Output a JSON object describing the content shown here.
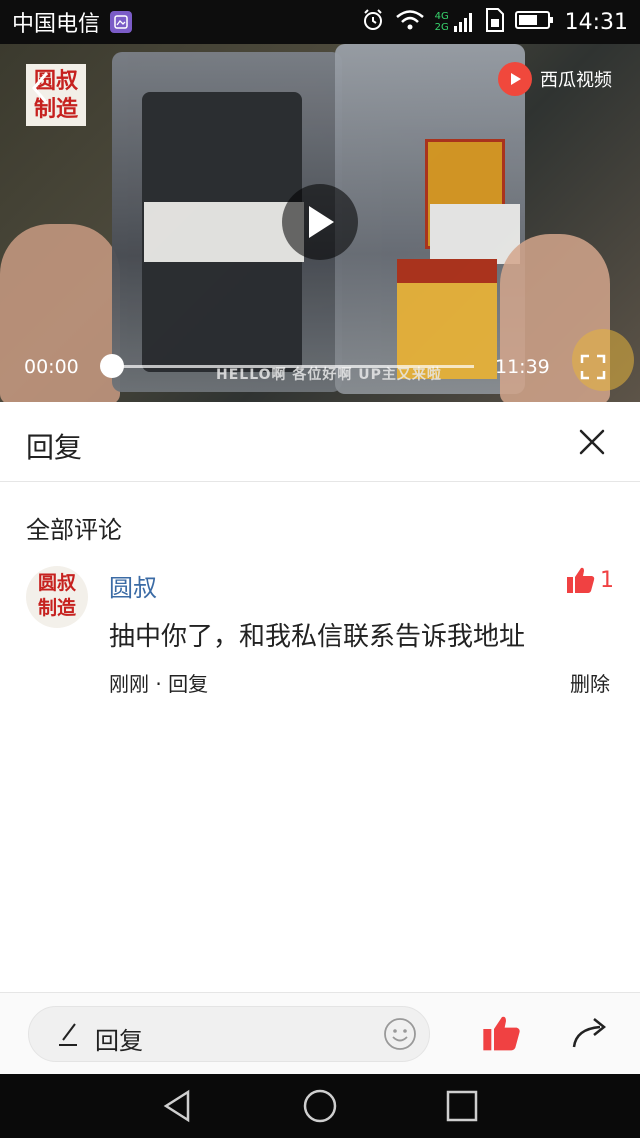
{
  "status_bar": {
    "carrier": "中国电信",
    "network": "4G 2G",
    "time": "14:31",
    "icons": [
      "gallery-icon",
      "alarm-icon",
      "wifi-icon",
      "signal-icon",
      "sim-icon",
      "battery-icon"
    ]
  },
  "video": {
    "logo_line1": "圆叔",
    "logo_line2": "制造",
    "brand": "西瓜视频",
    "current_time": "00:00",
    "total_time": "11:39",
    "progress": 0,
    "subtitle": "HELLO啊 各位好啊 UP主又来啦"
  },
  "reply_panel": {
    "title": "回复"
  },
  "comments_section": {
    "title": "全部评论"
  },
  "comment": {
    "avatar_line1": "圆叔",
    "avatar_line2": "制造",
    "username": "圆叔",
    "like_count": "1",
    "text": "抽中你了，和我私信联系告诉我地址",
    "meta": "刚刚 · 回复",
    "delete_label": "删除"
  },
  "bottom_bar": {
    "input_placeholder": "回复"
  },
  "colors": {
    "accent_red": "#f04142",
    "username_blue": "#3b6ba5",
    "logo_red": "#c6211f"
  }
}
